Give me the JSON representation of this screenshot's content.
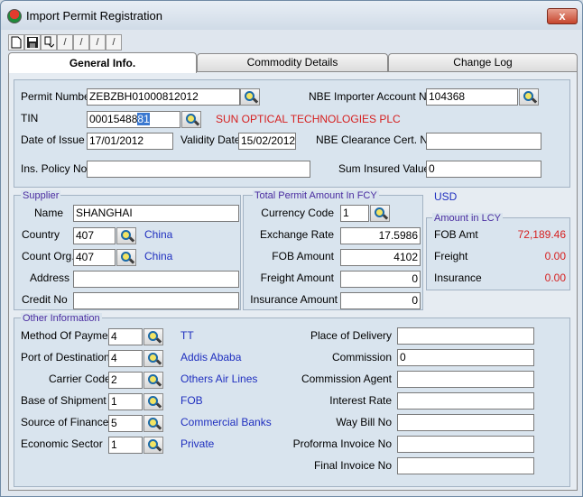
{
  "window": {
    "title": "Import Permit Registration",
    "close_label": "x"
  },
  "toolbar": {
    "tb_label": "/"
  },
  "tabs": [
    {
      "label": "General  Info."
    },
    {
      "label": "Commodity Details"
    },
    {
      "label": "Change Log"
    }
  ],
  "header": {
    "permit_number_label": "Permit Number",
    "permit_number_value": "ZEBZBH01000812012",
    "nbe_account_label": "NBE Importer Account No",
    "nbe_account_value": "104368",
    "tin_label": "TIN",
    "tin_value_prefix": "00015488",
    "tin_value_selected": "81",
    "company_name": "SUN OPTICAL TECHNOLOGIES PLC",
    "date_issue_label": "Date of Issue",
    "date_issue_value": "17/01/2012",
    "validity_label": "Validity Date",
    "validity_value": "15/02/2012",
    "clearance_label": "NBE Clearance Cert. No",
    "clearance_value": "",
    "policy_label": "Ins. Policy No.",
    "policy_value": "",
    "sum_insured_label": "Sum Insured Value",
    "sum_insured_value": "0"
  },
  "supplier": {
    "title": "Supplier",
    "name_label": "Name",
    "name_value": "SHANGHAI",
    "country_label": "Country",
    "country_code": "407",
    "country_name": "China",
    "origin_label": "Count Org.",
    "origin_code": "407",
    "origin_name": "China",
    "address_label": "Address",
    "address_value": "",
    "credit_label": "Credit No",
    "credit_value": ""
  },
  "fcy": {
    "title": "Total Permit Amount In FCY",
    "currency_label": "Currency Code",
    "currency_value": "1",
    "currency_name": "USD",
    "rate_label": "Exchange Rate",
    "rate_value": "17.5986",
    "fob_label": "FOB Amount",
    "fob_value": "4102",
    "freight_label": "Freight Amount",
    "freight_value": "0",
    "insurance_label": "Insurance Amount",
    "insurance_value": "0"
  },
  "lcy": {
    "title": "Amount in LCY",
    "fob_label": "FOB Amt",
    "fob_value": "72,189.46",
    "freight_label": "Freight",
    "freight_value": "0.00",
    "insurance_label": "Insurance",
    "insurance_value": "0.00"
  },
  "other": {
    "title": "Other Information",
    "method_label": "Method Of Payment",
    "method_code": "4",
    "method_name": "TT",
    "port_label": "Port of Destination",
    "port_code": "4",
    "port_name": "Addis Ababa",
    "carrier_label": "Carrier Code",
    "carrier_code": "2",
    "carrier_name": "Others Air Lines",
    "base_label": "Base of Shipment",
    "base_code": "1",
    "base_name": "FOB",
    "finance_label": "Source of Finance",
    "finance_code": "5",
    "finance_name": "Commercial Banks",
    "sector_label": "Economic Sector",
    "sector_code": "1",
    "sector_name": "Private",
    "delivery_label": "Place of Delivery",
    "delivery_value": "",
    "commission_label": "Commission",
    "commission_value": "0",
    "agent_label": "Commission Agent",
    "agent_value": "",
    "interest_label": "Interest Rate",
    "interest_value": "",
    "waybill_label": "Way Bill No",
    "waybill_value": "",
    "proforma_label": "Proforma Invoice No",
    "proforma_value": "",
    "final_label": "Final Invoice No",
    "final_value": ""
  }
}
